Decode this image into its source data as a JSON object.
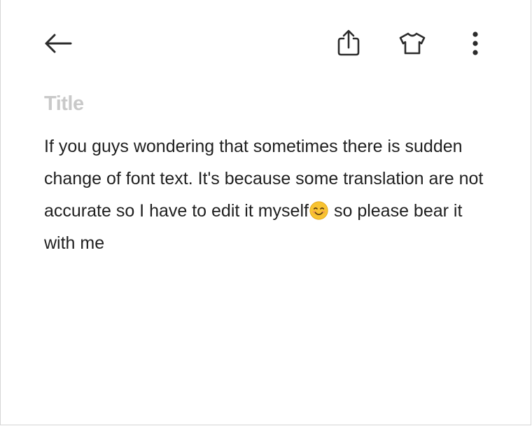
{
  "header": {
    "icons": {
      "back": "back-arrow-icon",
      "share": "share-icon",
      "theme": "tshirt-icon",
      "more": "more-vertical-icon"
    }
  },
  "note": {
    "title_placeholder": "Title",
    "body_before_emoji": "If you guys wondering that sometimes there is sudden change of font text. It's because some translation are not accurate so I have to edit it myself",
    "emoji": "smiling-face-emoji",
    "body_after_emoji": "so please bear it with me"
  },
  "colors": {
    "text": "#1f1f1f",
    "placeholder": "#c9c9c9",
    "icon": "#2b2b2b",
    "emoji_face": "#f8c331"
  }
}
